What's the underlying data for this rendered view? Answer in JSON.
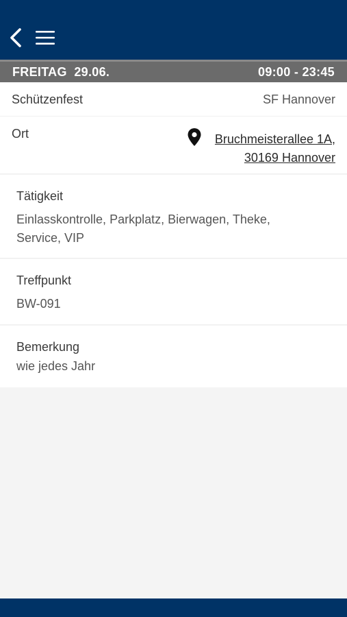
{
  "header": {
    "back_icon": "chevron-left-icon",
    "menu_icon": "hamburger-menu-icon",
    "bar_color": "#003366"
  },
  "datebar": {
    "date": "FREITAG  29.06.",
    "time": "09:00 - 23:45"
  },
  "event": {
    "label": "Schützenfest",
    "value": "SF Hannover"
  },
  "location": {
    "label": "Ort",
    "icon": "map-pin-icon",
    "address_line1": "Bruchmeisterallee 1A,",
    "address_line2": "30169 Hannover"
  },
  "activity": {
    "title": "Tätigkeit",
    "text": "Einlasskontrolle, Parkplatz, Bierwagen, Theke, Service, VIP"
  },
  "meeting_point": {
    "title": "Treffpunkt",
    "text": "BW-091"
  },
  "remark": {
    "title": "Bemerkung",
    "text": "wie jedes Jahr"
  }
}
